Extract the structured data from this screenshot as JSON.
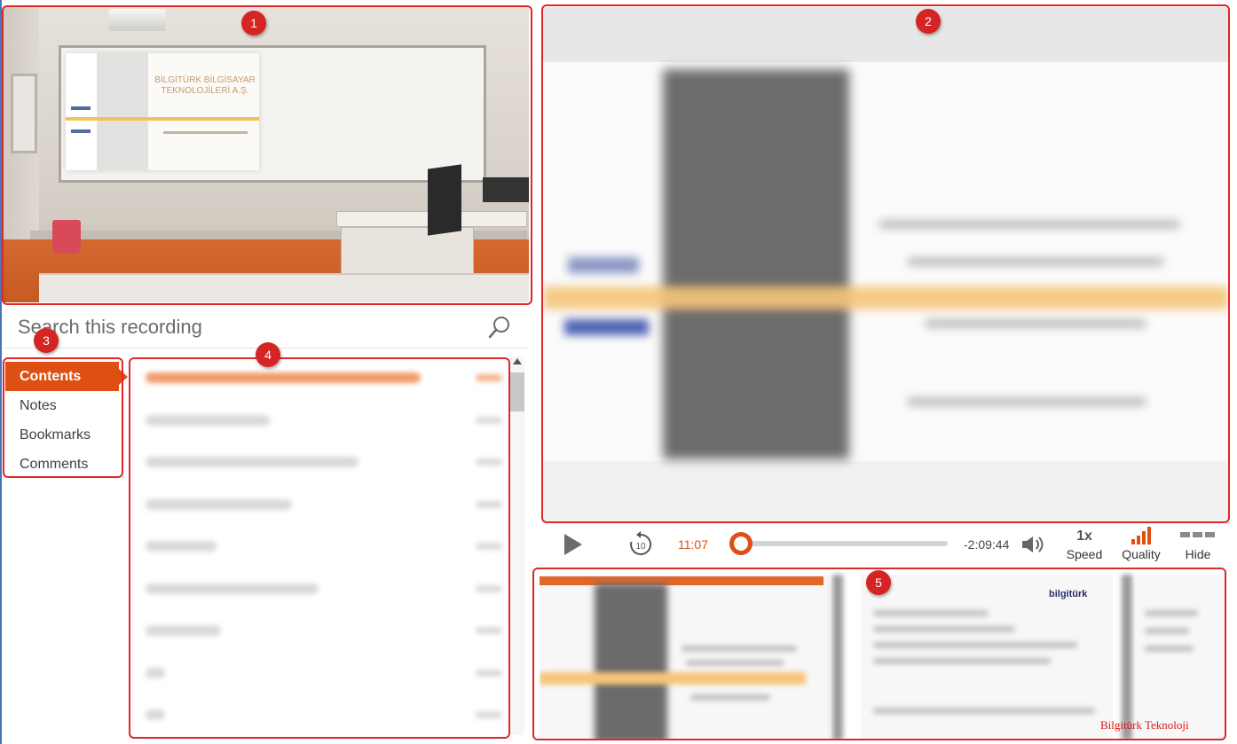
{
  "camera": {
    "slide_title": "BİLGİTÜRK BİLGİSAYAR TEKNOLOJİLERİ A.Ş."
  },
  "search": {
    "placeholder": "Search this recording"
  },
  "tabs": [
    {
      "label": "Contents",
      "active": true
    },
    {
      "label": "Notes",
      "active": false
    },
    {
      "label": "Bookmarks",
      "active": false
    },
    {
      "label": "Comments",
      "active": false
    }
  ],
  "player": {
    "current_time": "11:07",
    "remaining_time": "-2:09:44",
    "speed_value": "1x",
    "speed_label": "Speed",
    "quality_label": "Quality",
    "hide_label": "Hide",
    "progress_fraction": 0.02,
    "accent_color": "#dd4f13"
  },
  "thumbnails": {
    "brand": "bilgitürk"
  },
  "watermark": "Bilgitürk Teknoloji",
  "annotations": [
    "1",
    "2",
    "3",
    "4",
    "5"
  ],
  "icons": {
    "search": "search-icon",
    "play": "play-icon",
    "rewind": "rewind-10-icon",
    "volume": "volume-icon",
    "quality": "signal-bars-icon",
    "hide": "hide-dashes-icon"
  }
}
